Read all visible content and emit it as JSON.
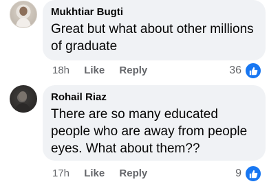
{
  "comments": [
    {
      "author": "Mukhtiar Bugti",
      "text": "Great but what about other millions of graduate",
      "time": "18h",
      "like_label": "Like",
      "reply_label": "Reply",
      "reaction_count": "36",
      "reaction_icon": "like-icon"
    },
    {
      "author": "Rohail Riaz",
      "text": "There are so many educated people who are away from people eyes. What about them??",
      "time": "17h",
      "like_label": "Like",
      "reply_label": "Reply",
      "reaction_count": "9",
      "reaction_icon": "like-icon"
    }
  ],
  "colors": {
    "bubble": "#f0f2f5",
    "meta": "#65676b",
    "like": "#1877f2"
  }
}
